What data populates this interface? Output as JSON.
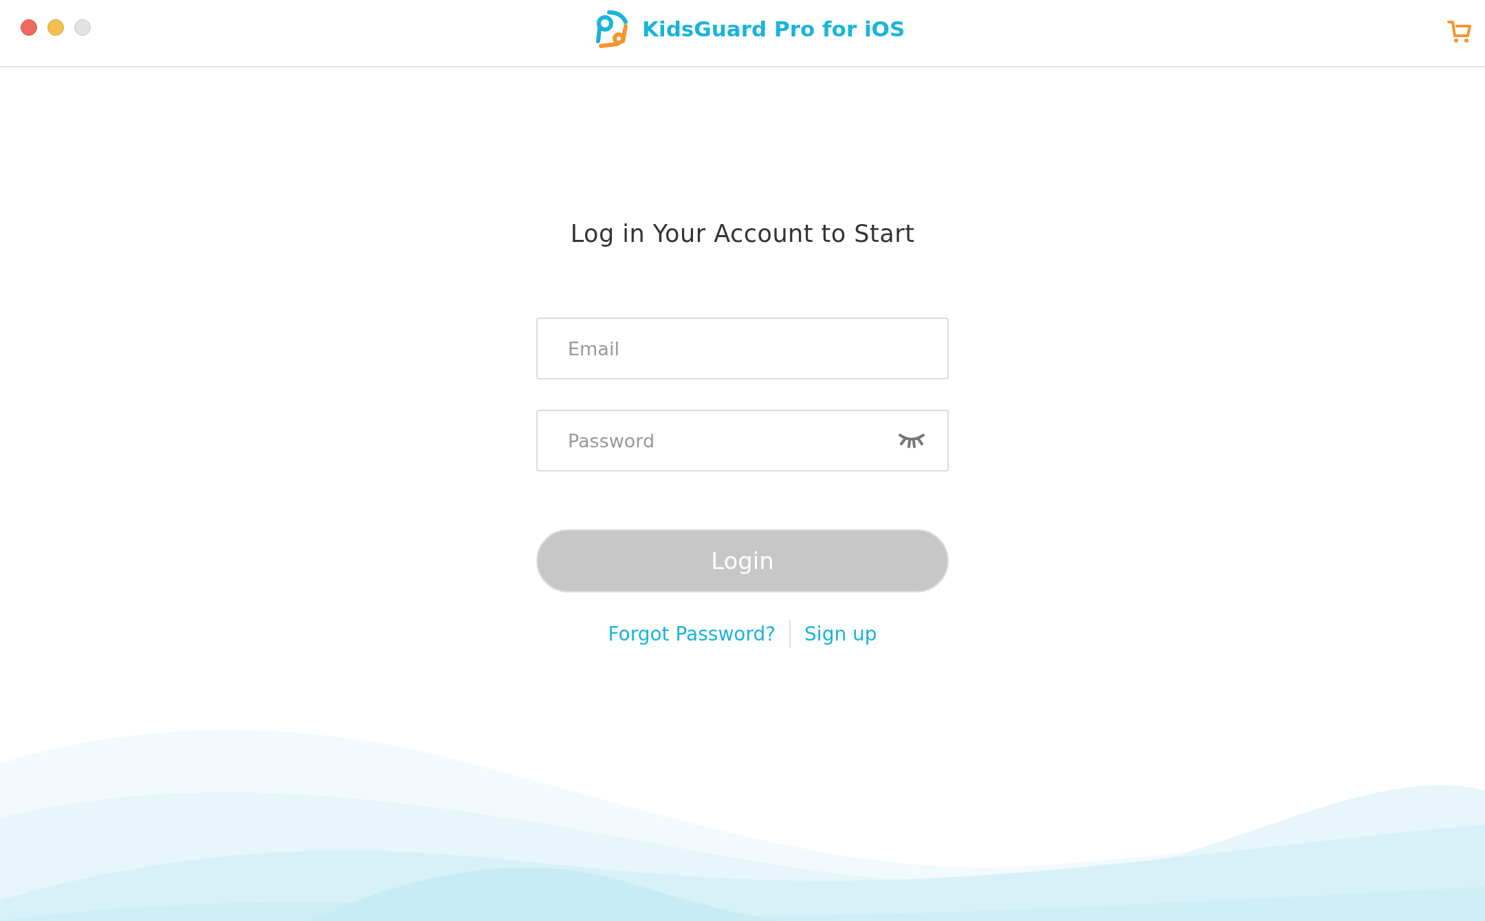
{
  "window": {
    "title": "KidsGuard Pro for iOS"
  },
  "login": {
    "heading": "Log in Your Account to Start",
    "fields": [
      {
        "kind": "email",
        "placeholder": "Email"
      },
      {
        "kind": "password",
        "placeholder": "Password"
      }
    ],
    "button": {
      "label": "Login",
      "disabled": true
    },
    "links": [
      "Forgot Password?",
      "Sign up"
    ]
  }
}
